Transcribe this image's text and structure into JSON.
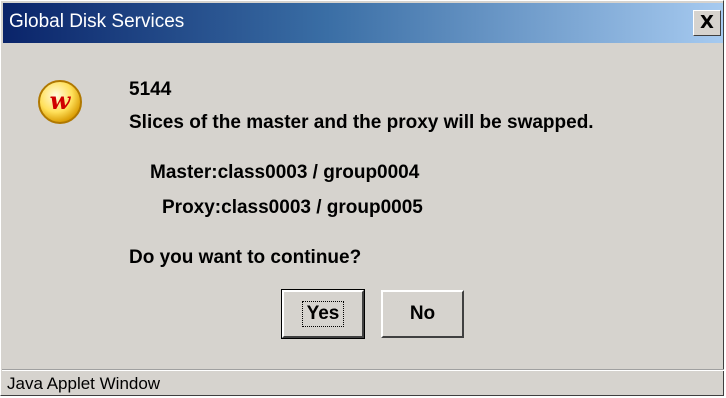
{
  "window": {
    "title": "Global Disk Services",
    "close_label": "X"
  },
  "icon": {
    "name": "web-w-icon",
    "glyph": "w",
    "colors": {
      "ring": "#f5c200",
      "fill": "#fff2a0",
      "letter": "#d00000"
    }
  },
  "message": {
    "code": "5144",
    "text": "Slices of the master and the proxy will be swapped.",
    "master": "Master:class0003 / group0004",
    "proxy": "Proxy:class0003 / group0005",
    "question": "Do you want to continue?"
  },
  "buttons": {
    "yes": "Yes",
    "no": "No"
  },
  "status": {
    "text": "Java Applet Window"
  }
}
